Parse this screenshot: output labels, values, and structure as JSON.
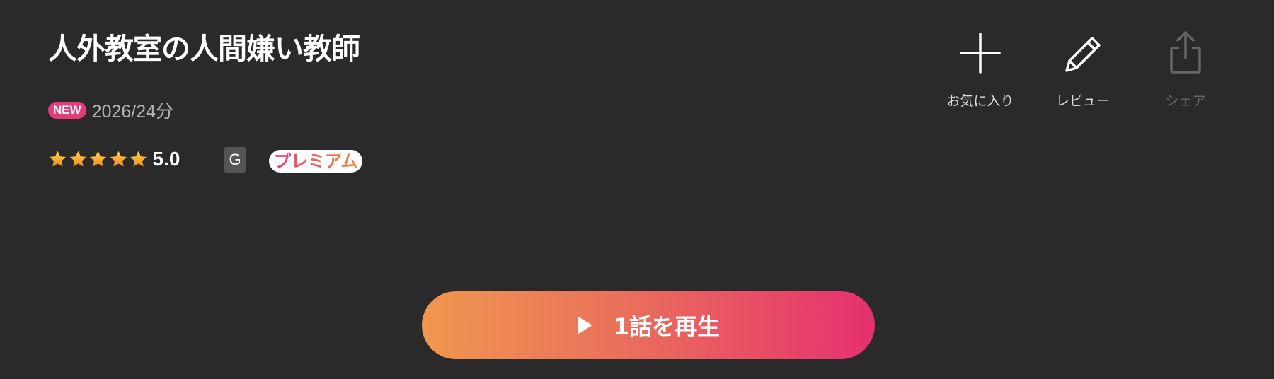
{
  "title": "人外教室の人間嫌い教師",
  "meta": {
    "new_badge": "NEW",
    "year_duration": "2026/24分"
  },
  "rating": {
    "value": "5.0",
    "stars": 5,
    "star_color": "#f5a623"
  },
  "age_rating": "G",
  "premium_label": "プレミアム",
  "actions": {
    "favorite": {
      "label": "お気に入り",
      "icon": "plus-icon"
    },
    "review": {
      "label": "レビュー",
      "icon": "pencil-icon"
    },
    "share": {
      "label": "シェア",
      "icon": "share-icon",
      "disabled": true
    }
  },
  "play_button": {
    "label": "1話を再生",
    "icon": "play-icon"
  },
  "colors": {
    "background": "#2a2a2a",
    "accent_pink": "#e63b7a",
    "accent_orange": "#f0974f"
  }
}
